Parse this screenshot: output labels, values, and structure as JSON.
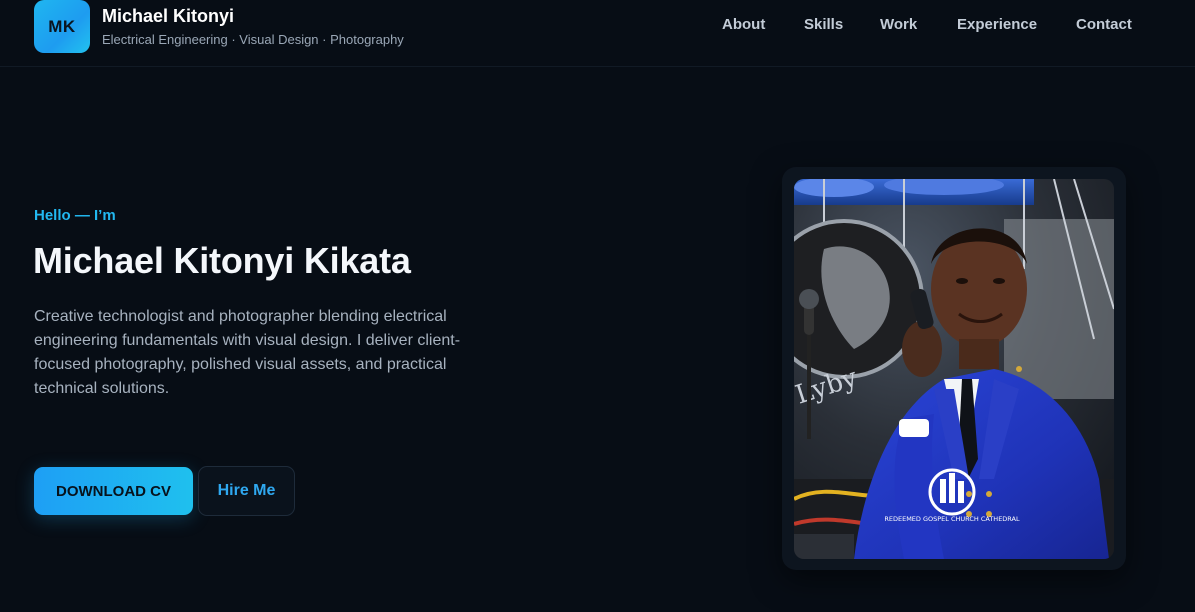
{
  "header": {
    "logo_initials": "MK",
    "name": "Michael Kitonyi",
    "tagline": "Electrical Engineering · Visual Design · Photography",
    "nav": [
      {
        "label": "About"
      },
      {
        "label": "Skills"
      },
      {
        "label": "Work"
      },
      {
        "label": "Experience"
      },
      {
        "label": "Contact"
      }
    ]
  },
  "hero": {
    "kicker": "Hello — I’m",
    "title": "Michael Kitonyi Kikata",
    "description": "Creative technologist and photographer blending electrical engineering fundamentals with visual design. I deliver client-focused photography, polished visual assets, and practical technical solutions.",
    "primary_button": "DOWNLOAD CV",
    "secondary_button": "Hire Me"
  },
  "photo": {
    "watermark_text": "REDEEMED GOSPEL CHURCH CATHEDRAL"
  },
  "colors": {
    "accent": "#22b8f0",
    "background": "#070d15",
    "button_gradient_start": "#1e9ff5",
    "button_gradient_end": "#1fc0ee"
  }
}
